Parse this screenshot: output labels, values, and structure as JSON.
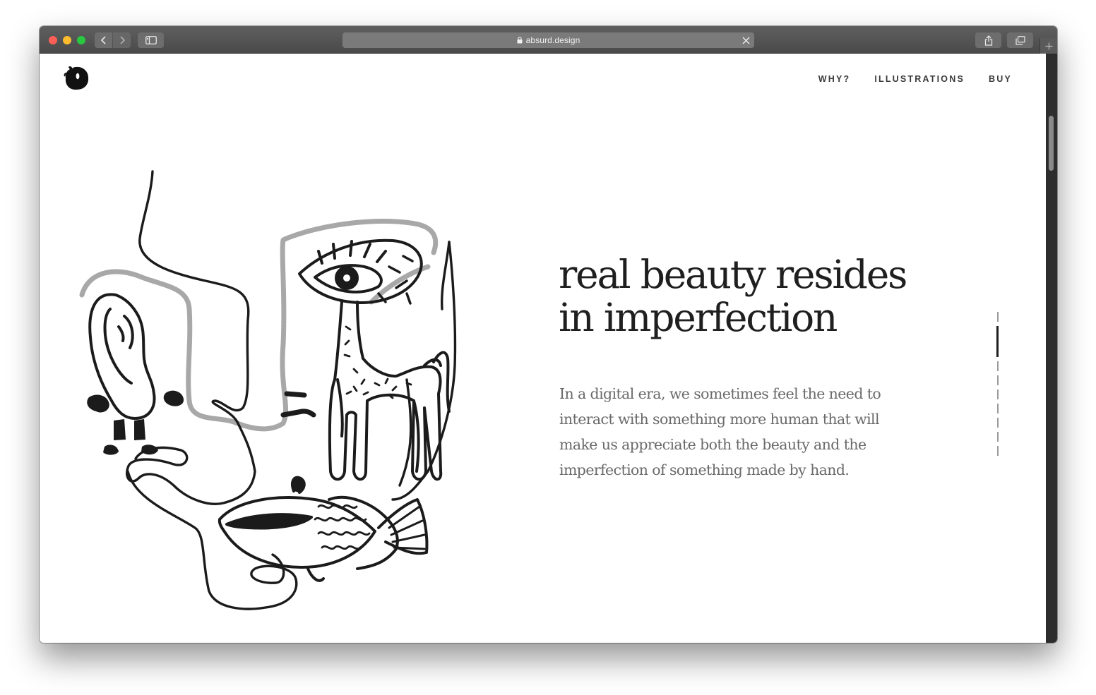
{
  "browser": {
    "url": "absurd.design"
  },
  "site": {
    "nav": [
      {
        "label": "WHY?"
      },
      {
        "label": "ILLUSTRATIONS"
      },
      {
        "label": "BUY"
      }
    ]
  },
  "hero": {
    "title_line1": "real beauty resides",
    "title_line2": "in imperfection",
    "text_line1": "In a digital era, we sometimes feel the need to",
    "text_line2": "interact with something more human that will",
    "text_line3": "make us appreciate both the beauty and the",
    "text_line4": "imperfection of something made by hand."
  },
  "slider": {
    "slides": 9,
    "active_slide": 2
  },
  "icons": {
    "logo": "ink-blob-logo",
    "illustration": "surreal-face-line-drawing"
  }
}
